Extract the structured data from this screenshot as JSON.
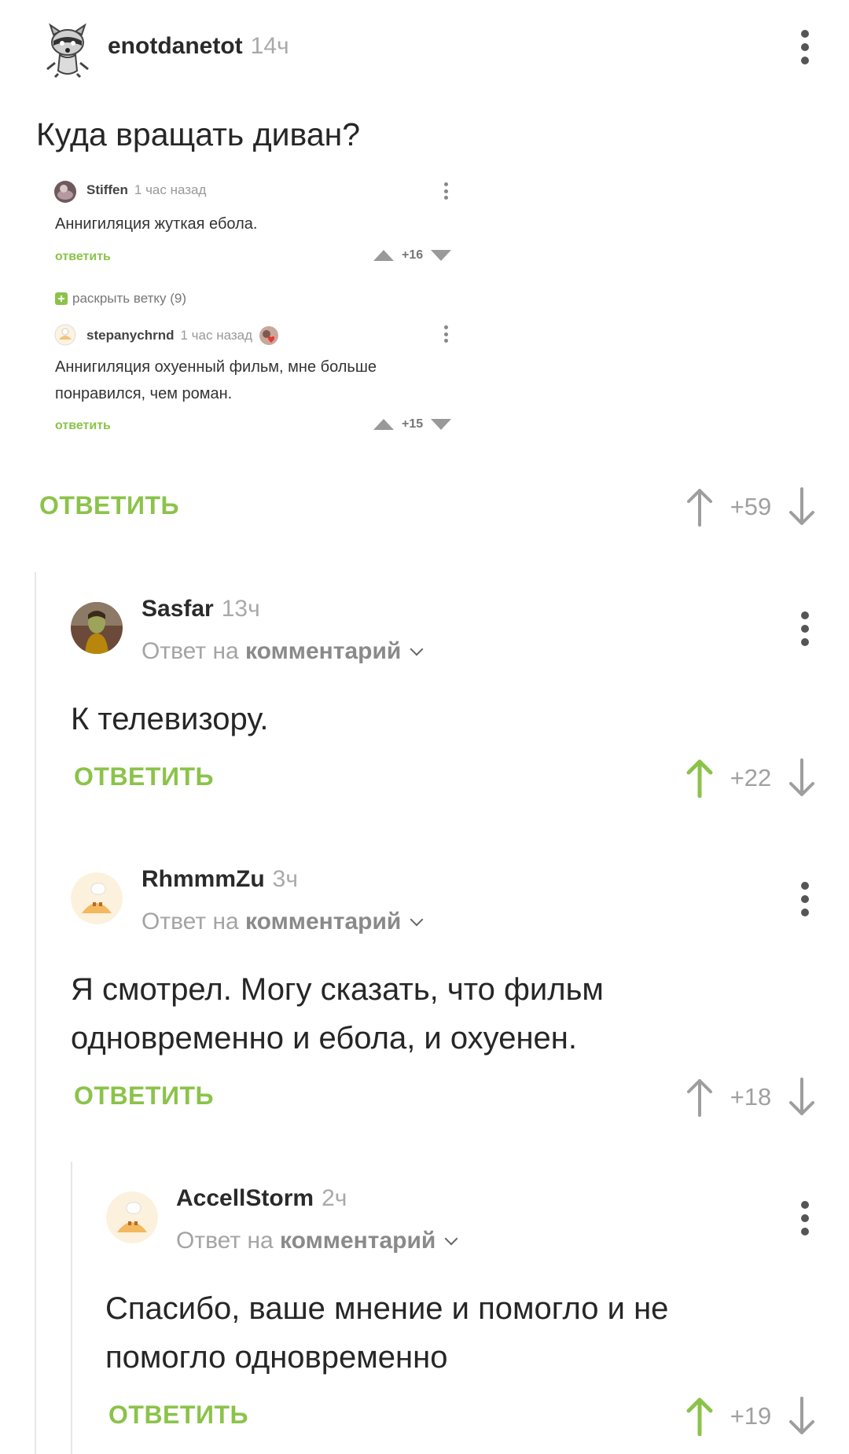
{
  "post": {
    "author": "enotdanetot",
    "time": "14ч",
    "title": "Куда вращать диван?",
    "reply_label": "ОТВЕТИТЬ",
    "score": "+59",
    "embedded_screenshot": {
      "c1_author": "Stiffen",
      "c1_time": "1 час назад",
      "c1_text": "Аннигиляция жуткая ебола.",
      "c1_reply": "ответить",
      "c1_score": "+16",
      "expand_label": "раскрыть ветку (9)",
      "c2_author": "stepanychrnd",
      "c2_time": "1 час назад",
      "c2_text_line1": "Аннигиляция охуенный фильм, мне больше",
      "c2_text_line2": "понравился, чем роман.",
      "c2_reply": "ответить",
      "c2_score": "+15"
    }
  },
  "comments": [
    {
      "author": "Sasfar",
      "time": "13ч",
      "reply_prefix": "Ответ на",
      "reply_target": "комментарий",
      "text": "К телевизору.",
      "reply_label": "ОТВЕТИТЬ",
      "score": "+22",
      "upvoted": true
    },
    {
      "author": "RhmmmZu",
      "time": "3ч",
      "reply_prefix": "Ответ на",
      "reply_target": "комментарий",
      "text_line1": "Я смотрел. Могу сказать, что фильм",
      "text_line2": "одновременно и ебола, и охуенен.",
      "reply_label": "ОТВЕТИТЬ",
      "score": "+18",
      "upvoted": false
    },
    {
      "author": "AccellStorm",
      "time": "2ч",
      "reply_prefix": "Ответ на",
      "reply_target": "комментарий",
      "text_line1": "Спасибо, ваше мнение и помогло и не",
      "text_line2": "помогло одновременно",
      "reply_label": "ОТВЕТИТЬ",
      "score": "+19",
      "upvoted": true
    }
  ],
  "colors": {
    "accent_green": "#8bc34a",
    "vote_neutral": "#9e9e9e",
    "vote_up_active": "#8bc34a"
  }
}
